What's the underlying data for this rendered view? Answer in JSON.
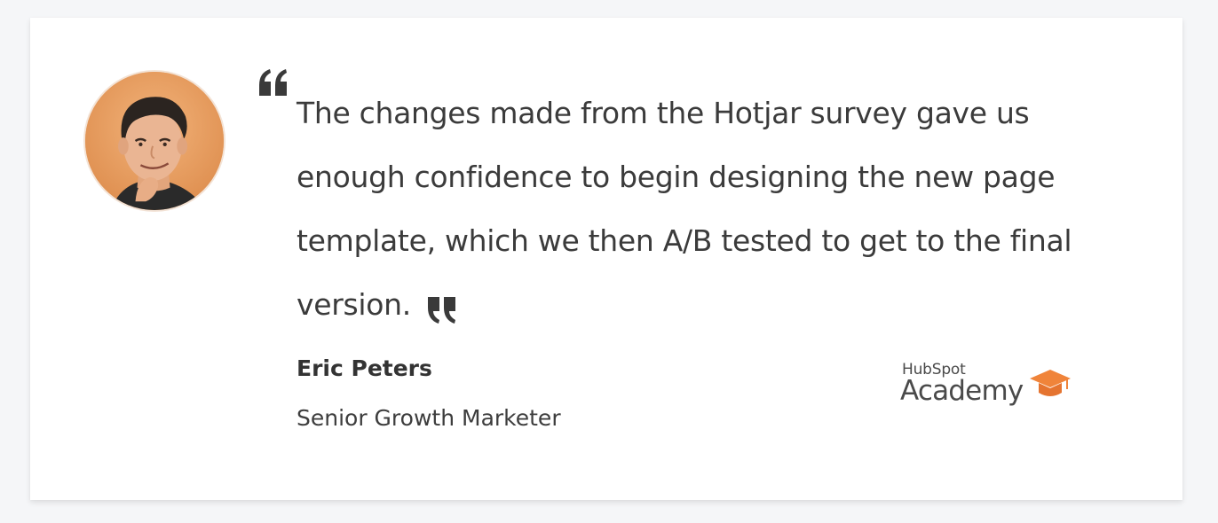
{
  "testimonial": {
    "quote": "The changes made from the Hotjar survey gave us enough confidence to begin designing the new page template, which we then A/B tested to get to the final version.",
    "author_name": "Eric Peters",
    "author_title": "Senior Growth Marketer"
  },
  "logo": {
    "line1": "HubSpot",
    "line2": "Academy",
    "cap_color": "#f0843a"
  },
  "icons": {
    "open_quote": "quote-open-icon",
    "close_quote": "quote-close-icon",
    "avatar": "avatar-photo",
    "cap": "graduation-cap-icon"
  },
  "colors": {
    "page_background": "#f5f6f8",
    "card_background": "#ffffff",
    "text": "#3b3b3b",
    "avatar_background": "#e89a5b"
  }
}
